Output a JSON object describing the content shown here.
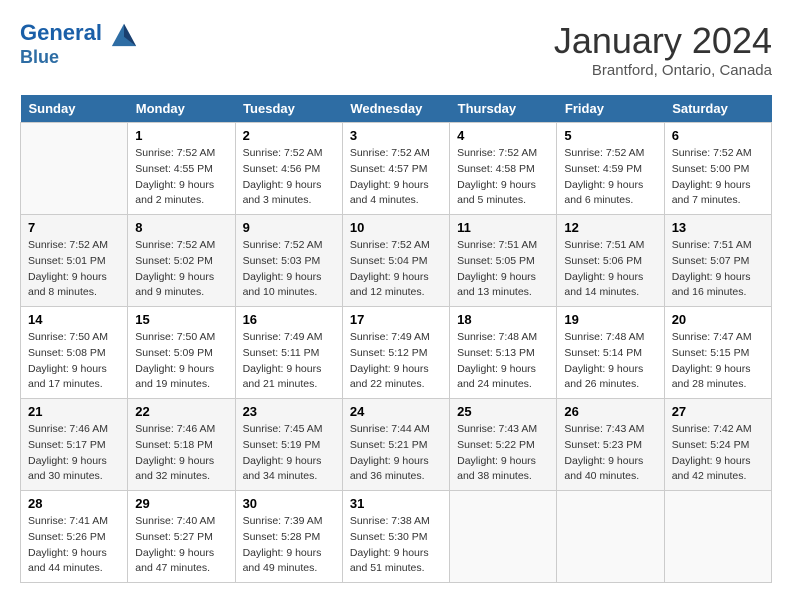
{
  "header": {
    "logo_line1": "General",
    "logo_line2": "Blue",
    "month": "January 2024",
    "location": "Brantford, Ontario, Canada"
  },
  "days_of_week": [
    "Sunday",
    "Monday",
    "Tuesday",
    "Wednesday",
    "Thursday",
    "Friday",
    "Saturday"
  ],
  "weeks": [
    [
      {
        "num": "",
        "detail": ""
      },
      {
        "num": "1",
        "detail": "Sunrise: 7:52 AM\nSunset: 4:55 PM\nDaylight: 9 hours\nand 2 minutes."
      },
      {
        "num": "2",
        "detail": "Sunrise: 7:52 AM\nSunset: 4:56 PM\nDaylight: 9 hours\nand 3 minutes."
      },
      {
        "num": "3",
        "detail": "Sunrise: 7:52 AM\nSunset: 4:57 PM\nDaylight: 9 hours\nand 4 minutes."
      },
      {
        "num": "4",
        "detail": "Sunrise: 7:52 AM\nSunset: 4:58 PM\nDaylight: 9 hours\nand 5 minutes."
      },
      {
        "num": "5",
        "detail": "Sunrise: 7:52 AM\nSunset: 4:59 PM\nDaylight: 9 hours\nand 6 minutes."
      },
      {
        "num": "6",
        "detail": "Sunrise: 7:52 AM\nSunset: 5:00 PM\nDaylight: 9 hours\nand 7 minutes."
      }
    ],
    [
      {
        "num": "7",
        "detail": "Sunrise: 7:52 AM\nSunset: 5:01 PM\nDaylight: 9 hours\nand 8 minutes."
      },
      {
        "num": "8",
        "detail": "Sunrise: 7:52 AM\nSunset: 5:02 PM\nDaylight: 9 hours\nand 9 minutes."
      },
      {
        "num": "9",
        "detail": "Sunrise: 7:52 AM\nSunset: 5:03 PM\nDaylight: 9 hours\nand 10 minutes."
      },
      {
        "num": "10",
        "detail": "Sunrise: 7:52 AM\nSunset: 5:04 PM\nDaylight: 9 hours\nand 12 minutes."
      },
      {
        "num": "11",
        "detail": "Sunrise: 7:51 AM\nSunset: 5:05 PM\nDaylight: 9 hours\nand 13 minutes."
      },
      {
        "num": "12",
        "detail": "Sunrise: 7:51 AM\nSunset: 5:06 PM\nDaylight: 9 hours\nand 14 minutes."
      },
      {
        "num": "13",
        "detail": "Sunrise: 7:51 AM\nSunset: 5:07 PM\nDaylight: 9 hours\nand 16 minutes."
      }
    ],
    [
      {
        "num": "14",
        "detail": "Sunrise: 7:50 AM\nSunset: 5:08 PM\nDaylight: 9 hours\nand 17 minutes."
      },
      {
        "num": "15",
        "detail": "Sunrise: 7:50 AM\nSunset: 5:09 PM\nDaylight: 9 hours\nand 19 minutes."
      },
      {
        "num": "16",
        "detail": "Sunrise: 7:49 AM\nSunset: 5:11 PM\nDaylight: 9 hours\nand 21 minutes."
      },
      {
        "num": "17",
        "detail": "Sunrise: 7:49 AM\nSunset: 5:12 PM\nDaylight: 9 hours\nand 22 minutes."
      },
      {
        "num": "18",
        "detail": "Sunrise: 7:48 AM\nSunset: 5:13 PM\nDaylight: 9 hours\nand 24 minutes."
      },
      {
        "num": "19",
        "detail": "Sunrise: 7:48 AM\nSunset: 5:14 PM\nDaylight: 9 hours\nand 26 minutes."
      },
      {
        "num": "20",
        "detail": "Sunrise: 7:47 AM\nSunset: 5:15 PM\nDaylight: 9 hours\nand 28 minutes."
      }
    ],
    [
      {
        "num": "21",
        "detail": "Sunrise: 7:46 AM\nSunset: 5:17 PM\nDaylight: 9 hours\nand 30 minutes."
      },
      {
        "num": "22",
        "detail": "Sunrise: 7:46 AM\nSunset: 5:18 PM\nDaylight: 9 hours\nand 32 minutes."
      },
      {
        "num": "23",
        "detail": "Sunrise: 7:45 AM\nSunset: 5:19 PM\nDaylight: 9 hours\nand 34 minutes."
      },
      {
        "num": "24",
        "detail": "Sunrise: 7:44 AM\nSunset: 5:21 PM\nDaylight: 9 hours\nand 36 minutes."
      },
      {
        "num": "25",
        "detail": "Sunrise: 7:43 AM\nSunset: 5:22 PM\nDaylight: 9 hours\nand 38 minutes."
      },
      {
        "num": "26",
        "detail": "Sunrise: 7:43 AM\nSunset: 5:23 PM\nDaylight: 9 hours\nand 40 minutes."
      },
      {
        "num": "27",
        "detail": "Sunrise: 7:42 AM\nSunset: 5:24 PM\nDaylight: 9 hours\nand 42 minutes."
      }
    ],
    [
      {
        "num": "28",
        "detail": "Sunrise: 7:41 AM\nSunset: 5:26 PM\nDaylight: 9 hours\nand 44 minutes."
      },
      {
        "num": "29",
        "detail": "Sunrise: 7:40 AM\nSunset: 5:27 PM\nDaylight: 9 hours\nand 47 minutes."
      },
      {
        "num": "30",
        "detail": "Sunrise: 7:39 AM\nSunset: 5:28 PM\nDaylight: 9 hours\nand 49 minutes."
      },
      {
        "num": "31",
        "detail": "Sunrise: 7:38 AM\nSunset: 5:30 PM\nDaylight: 9 hours\nand 51 minutes."
      },
      {
        "num": "",
        "detail": ""
      },
      {
        "num": "",
        "detail": ""
      },
      {
        "num": "",
        "detail": ""
      }
    ]
  ]
}
